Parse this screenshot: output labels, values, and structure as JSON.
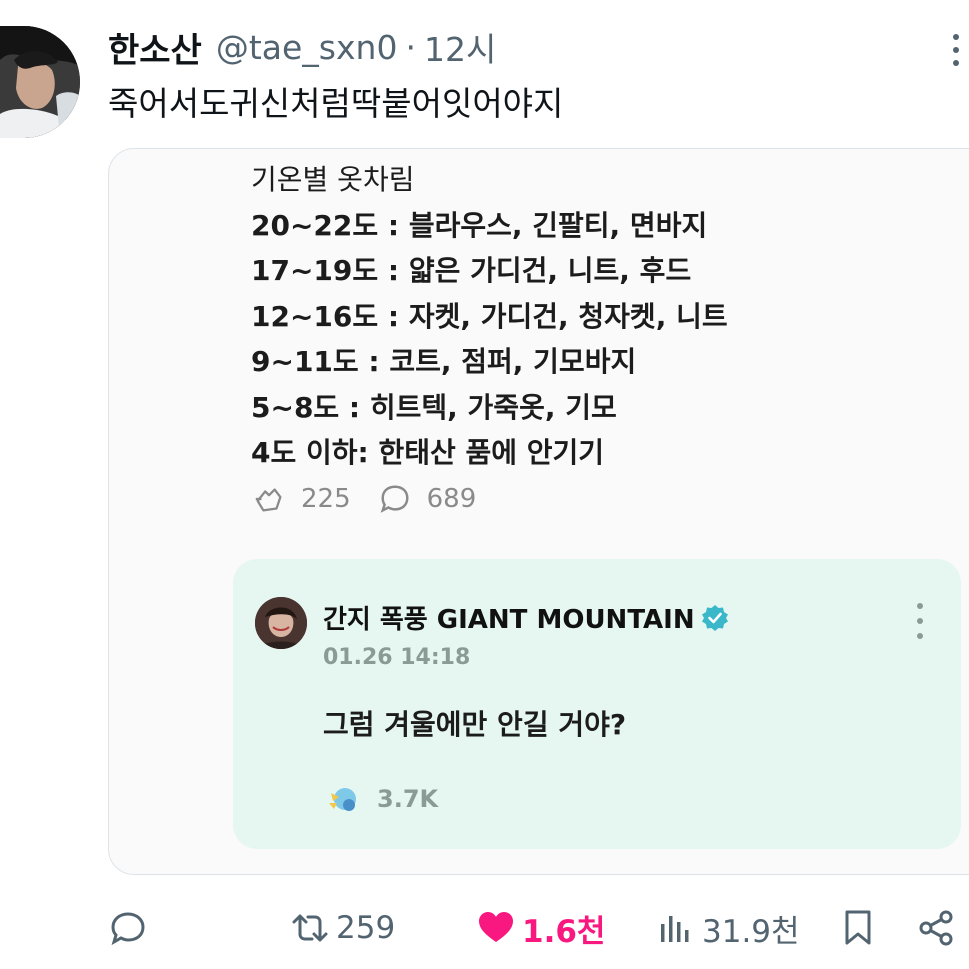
{
  "tweet": {
    "display_name": "한소산",
    "handle": "@tae_sxn0",
    "separator": "·",
    "time": "12시",
    "text": "죽어서도귀신처럼딱붙어잇어야지"
  },
  "embedded_image": {
    "lines": [
      "기온별 옷차림",
      "20~22도 : 블라우스, 긴팔티, 면바지",
      "17~19도 : 얇은 가디건, 니트, 후드",
      "12~16도 : 자켓, 가디건, 청자켓, 니트",
      "9~11도 : 코트, 점퍼, 기모바지",
      "5~8도 : 히트텍, 가죽옷, 기모",
      "4도 이하: 한태산 품에 안기기"
    ],
    "stats": {
      "reposts": "225",
      "comments": "689"
    },
    "reply": {
      "name": "간지 폭풍 GIANT MOUNTAIN",
      "date": "01.26 14:18",
      "text": "그럼 겨울에만 안길 거야?",
      "reactions": "3.7K"
    }
  },
  "actions": {
    "retweets": "259",
    "likes": "1.6천",
    "views": "31.9천"
  },
  "icons": {
    "reply": "comment-icon",
    "retweet": "retweet-icon",
    "like": "heart-icon",
    "views": "views-icon",
    "bookmark": "bookmark-icon",
    "share": "share-icon"
  },
  "colors": {
    "like": "#f91880",
    "secondary_text": "#536471",
    "reply_card_bg": "#e6f7f2",
    "verified": "#3ab7c9"
  }
}
